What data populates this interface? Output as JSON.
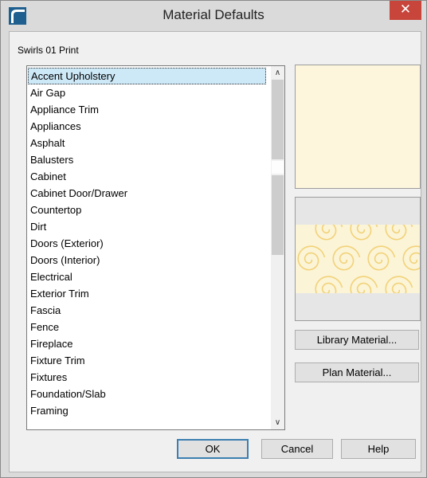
{
  "window": {
    "title": "Material Defaults",
    "close_glyph": "✕"
  },
  "material_name": "Swirls 01 Print",
  "list": {
    "items": [
      "Accent Upholstery",
      "Air Gap",
      "Appliance Trim",
      "Appliances",
      "Asphalt",
      "Balusters",
      "Cabinet",
      "Cabinet Door/Drawer",
      "Countertop",
      "Dirt",
      "Doors (Exterior)",
      "Doors (Interior)",
      "Electrical",
      "Exterior Trim",
      "Fascia",
      "Fence",
      "Fireplace",
      "Fixture Trim",
      "Fixtures",
      "Foundation/Slab",
      "Framing"
    ],
    "selected": "Accent Upholstery"
  },
  "scrollbar": {
    "up_glyph": "∧",
    "down_glyph": "∨",
    "position": 0.3
  },
  "preview": {
    "top_color": "#fdf6dc",
    "pattern_background": "#fbf4d6",
    "pattern_color": "#f2d27a",
    "frame_color": "#e6e6e6"
  },
  "buttons": {
    "library_material": "Library Material...",
    "plan_material": "Plan Material...",
    "ok": "OK",
    "cancel": "Cancel",
    "help": "Help"
  },
  "icons": {
    "app": "app-logo-icon",
    "close": "close-icon"
  }
}
